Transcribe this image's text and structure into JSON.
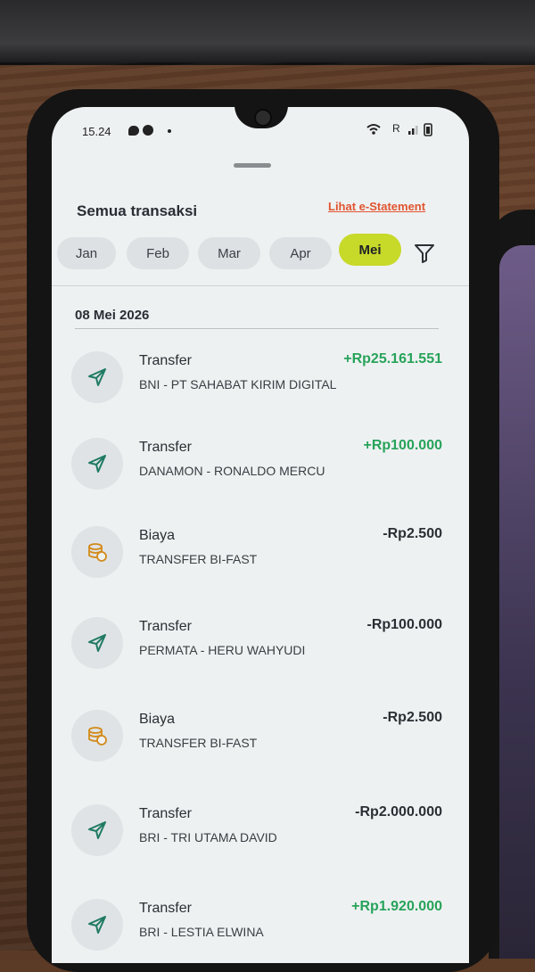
{
  "status_bar": {
    "time": "15.24",
    "network_label": "R"
  },
  "header": {
    "title": "Semua transaksi",
    "estatement_link": "Lihat e-Statement"
  },
  "months": [
    {
      "label": "Jan",
      "active": false
    },
    {
      "label": "Feb",
      "active": false
    },
    {
      "label": "Mar",
      "active": false
    },
    {
      "label": "Apr",
      "active": false
    },
    {
      "label": "Mei",
      "active": true
    }
  ],
  "date_group": "08 Mei 2026",
  "transactions": [
    {
      "type": "Transfer",
      "icon": "send-icon",
      "description": "BNI - PT SAHABAT KIRIM DIGITAL",
      "amount": "+Rp25.161.551",
      "direction": "in"
    },
    {
      "type": "Transfer",
      "icon": "send-icon",
      "description": "DANAMON - RONALDO MERCU",
      "amount": "+Rp100.000",
      "direction": "in"
    },
    {
      "type": "Biaya",
      "icon": "coin-stack-icon",
      "description": "TRANSFER BI-FAST",
      "amount": "-Rp2.500",
      "direction": "out"
    },
    {
      "type": "Transfer",
      "icon": "send-icon",
      "description": "PERMATA - HERU WAHYUDI",
      "amount": "-Rp100.000",
      "direction": "out"
    },
    {
      "type": "Biaya",
      "icon": "coin-stack-icon",
      "description": "TRANSFER BI-FAST",
      "amount": "-Rp2.500",
      "direction": "out"
    },
    {
      "type": "Transfer",
      "icon": "send-icon",
      "description": "BRI - TRI UTAMA DAVID",
      "amount": "-Rp2.000.000",
      "direction": "out"
    },
    {
      "type": "Transfer",
      "icon": "send-icon",
      "description": "BRI - LESTIA ELWINA",
      "amount": "+Rp1.920.000",
      "direction": "in"
    }
  ],
  "colors": {
    "accent": "#c7d929",
    "positive": "#27a35a",
    "link": "#e05530"
  }
}
